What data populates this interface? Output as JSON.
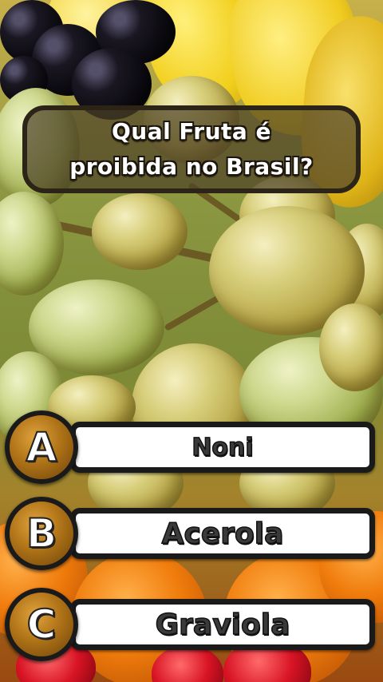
{
  "question": {
    "text": "Qual Fruta é\nproibida no Brasil?"
  },
  "answers": [
    {
      "letter": "A",
      "label": "Noni"
    },
    {
      "letter": "B",
      "label": "Acerola"
    },
    {
      "letter": "C",
      "label": "Graviola"
    }
  ],
  "colors": {
    "question_box": "#4e4228",
    "letter_circle": "#b07418",
    "answer_bar": "#ffffff",
    "outline": "#1a1a1a"
  }
}
